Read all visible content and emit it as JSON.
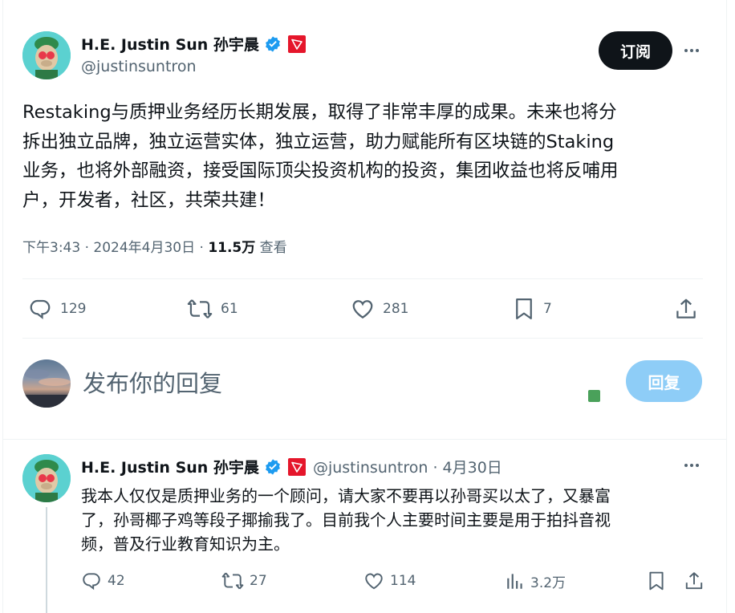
{
  "tweet": {
    "author_name": "H.E. Justin Sun 孙宇晨",
    "handle": "@justinsuntron",
    "follow_label": "订阅",
    "text": "Restaking与质押业务经历长期发展，取得了非常丰厚的成果。未来也将分\n拆出独立品牌，独立运营实体，独立运营，助力赋能所有区块链的Staking\n业务，也将外部融资，接受国际顶尖投资机构的投资，集团收益也将反哺用\n户，开发者，社区，共荣共建！",
    "time": "下午3:43 · 2024年4月30日 · ",
    "views_count": "11.5万",
    "views_label": " 查看",
    "actions": {
      "replies": "129",
      "retweets": "61",
      "likes": "281",
      "bookmarks": "7"
    }
  },
  "composer": {
    "placeholder": "发布你的回复",
    "reply_button": "回复"
  },
  "reply": {
    "author_name": "H.E. Justin Sun 孙宇晨",
    "handle_date": "@justinsuntron · 4月30日",
    "text": "我本人仅仅是质押业务的一个顾问，请大家不要再以孙哥买以太了，又暴富\n了，孙哥椰子鸡等段子揶揄我了。目前我个人主要时间主要是用于拍抖音视\n频，普及行业教育知识为主。",
    "actions": {
      "replies": "42",
      "retweets": "27",
      "likes": "114",
      "views": "3.2万"
    }
  },
  "colors": {
    "accent": "#1d9bf0",
    "reply_button_bg": "#8ecdf7",
    "tron_red": "#e5162b",
    "muted": "#536471"
  }
}
